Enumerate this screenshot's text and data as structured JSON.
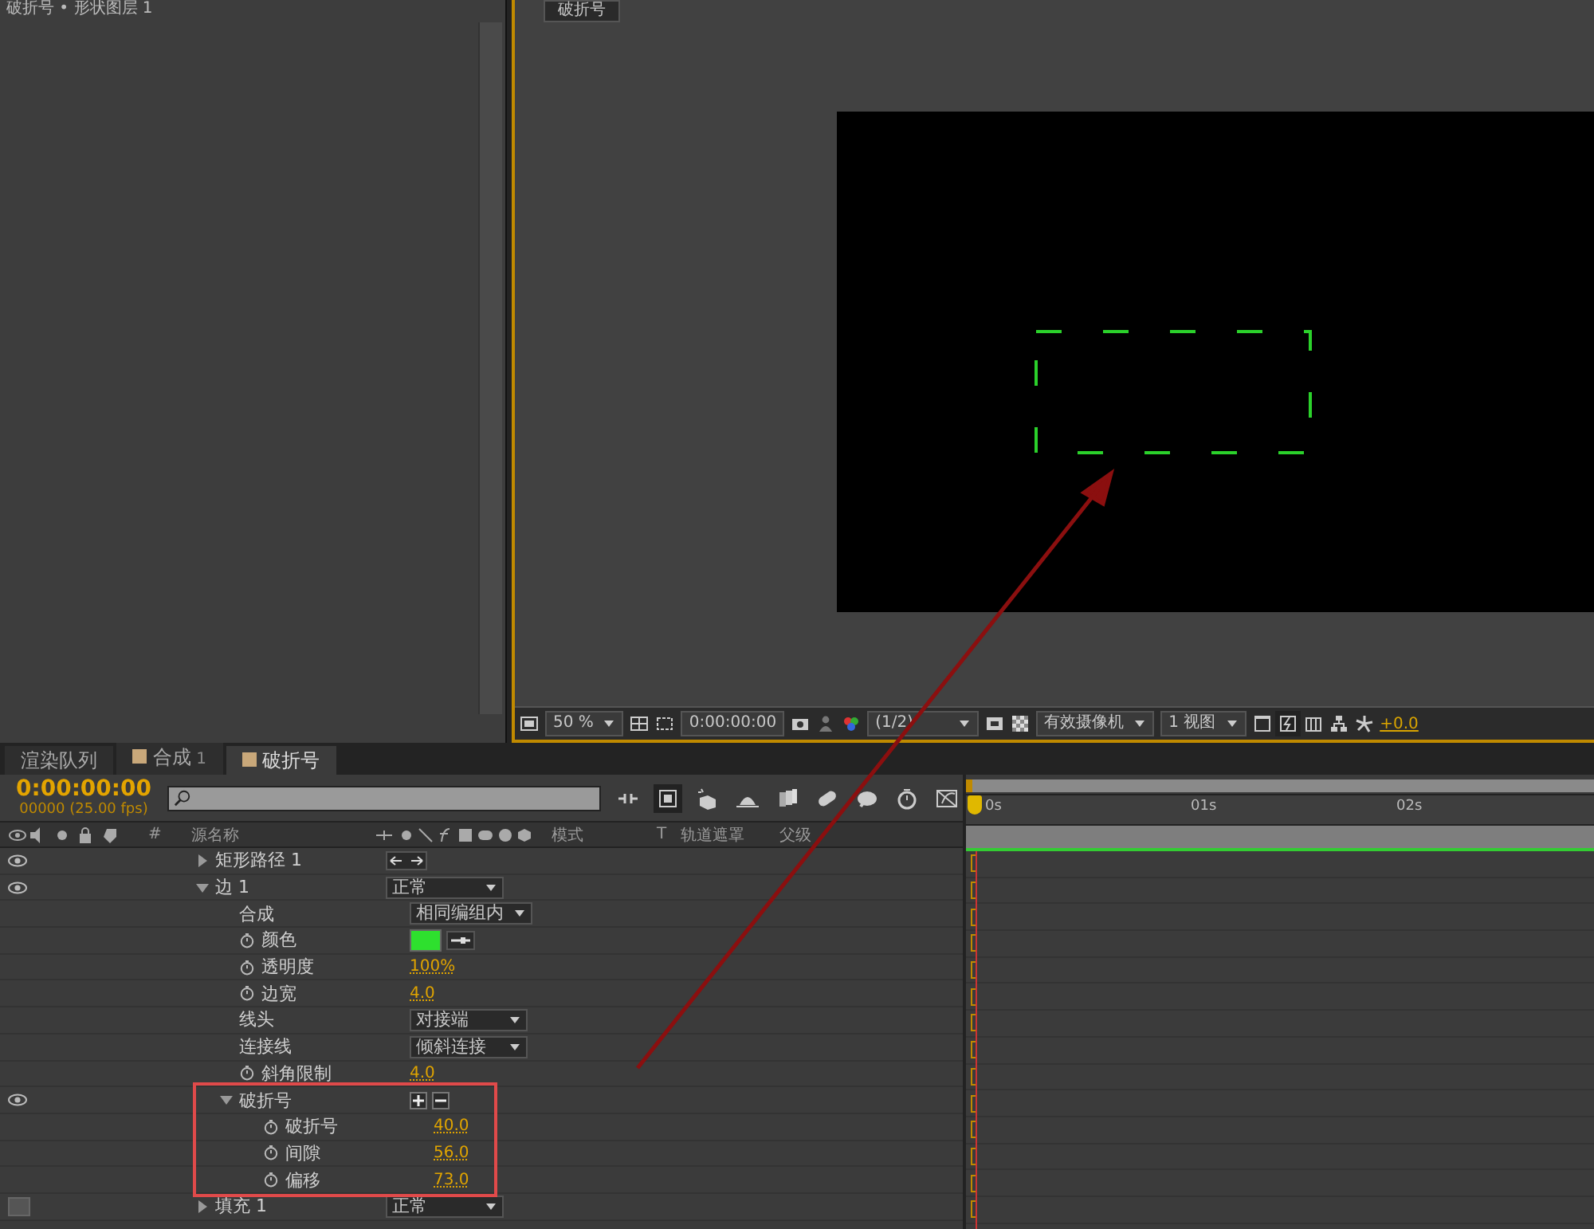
{
  "project_panel": {
    "title": "破折号 • 形状图层 1"
  },
  "viewer": {
    "tab": "破折号",
    "zoom": "50 %",
    "time": "0:00:00:00",
    "resolution": "(1/2)",
    "camera": "有效摄像机",
    "views": "1 视图",
    "exposure": "+0.0"
  },
  "timeline": {
    "tabs": [
      {
        "label": "渲染队列",
        "selected": false,
        "swatch": false
      },
      {
        "label": "合成",
        "count": "1",
        "selected": false,
        "swatch": true
      },
      {
        "label": "破折号",
        "selected": true,
        "swatch": true
      }
    ],
    "timecode": "0:00:00:00",
    "frame_info": "00000 (25.00 fps)",
    "columns": {
      "number": "#",
      "source": "源名称",
      "mode": "模式",
      "t": "T",
      "matte": "轨道遮罩",
      "parent": "父级"
    },
    "ruler": [
      "0s",
      "01s",
      "02s"
    ],
    "layers": [
      {
        "name": "矩形路径 1",
        "kind": "arrows",
        "expanded": false,
        "visible": true
      },
      {
        "name": "边 1",
        "kind": "dropdown",
        "value": "正常",
        "expanded": true,
        "visible": true,
        "children": [
          {
            "name": "合成",
            "kind": "dropdown",
            "value": "相同编组内"
          },
          {
            "name": "颜色",
            "kind": "swatch",
            "color": "#2ee02e",
            "stopwatch": true
          },
          {
            "name": "透明度",
            "kind": "value",
            "value": "100%",
            "stopwatch": true
          },
          {
            "name": "边宽",
            "kind": "value",
            "value": "4.0",
            "stopwatch": true
          },
          {
            "name": "线头",
            "kind": "dropdown",
            "value": "对接端"
          },
          {
            "name": "连接线",
            "kind": "dropdown",
            "value": "倾斜连接"
          },
          {
            "name": "斜角限制",
            "kind": "value",
            "value": "4.0",
            "stopwatch": true
          },
          {
            "name": "破折号",
            "kind": "plus-minus",
            "expanded": true,
            "visible": true,
            "children": [
              {
                "name": "破折号",
                "kind": "value",
                "value": "40.0",
                "stopwatch": true
              },
              {
                "name": "间隙",
                "kind": "value",
                "value": "56.0",
                "stopwatch": true
              },
              {
                "name": "偏移",
                "kind": "value",
                "value": "73.0",
                "stopwatch": true
              }
            ]
          }
        ]
      },
      {
        "name": "填充 1",
        "kind": "dropdown",
        "value": "正常",
        "expanded": false,
        "visible": false
      }
    ]
  }
}
